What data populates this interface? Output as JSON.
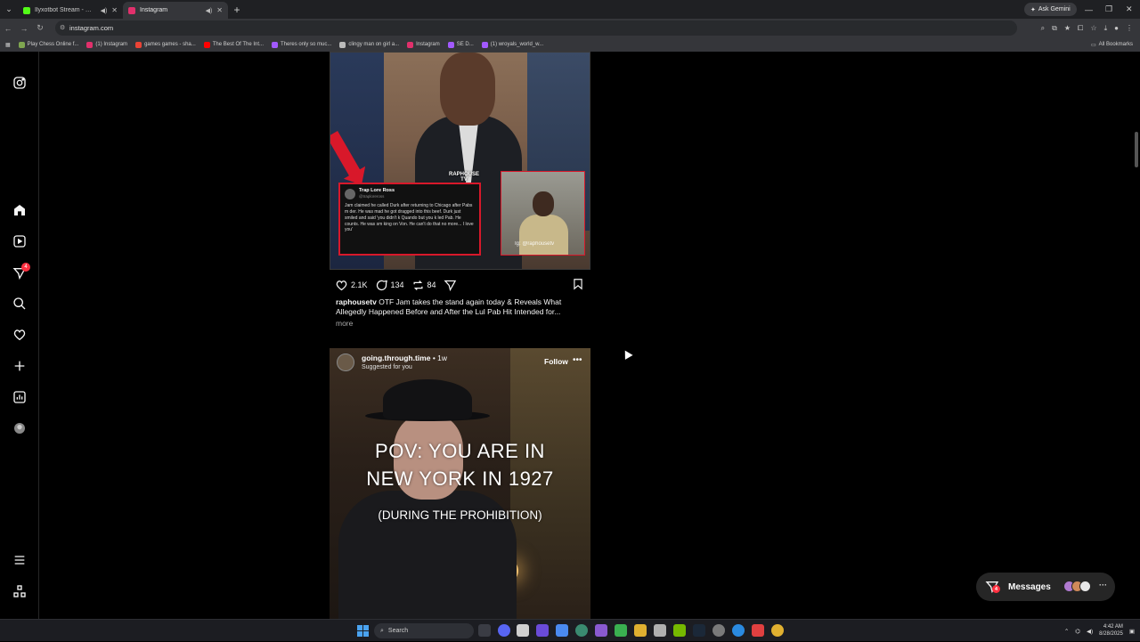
{
  "browser": {
    "tabs": [
      {
        "title": "Ilyxotbot Stream - Watch Li",
        "color": "#53fc18",
        "active": false
      },
      {
        "title": "Instagram",
        "color": "#e1306c",
        "active": true
      }
    ],
    "ask_gemini": "Ask Gemini",
    "url": "instagram.com",
    "bookmarks": [
      {
        "label": "Play Chess Online f...",
        "color": "#7fa650"
      },
      {
        "label": "(1) Instagram",
        "color": "#e1306c"
      },
      {
        "label": "games games - sha...",
        "color": "#ea4335"
      },
      {
        "label": "The Best Of The Int...",
        "color": "#ff0000"
      },
      {
        "label": "Theres only so muc...",
        "color": "#a259ff"
      },
      {
        "label": "clingy man on girl a...",
        "color": "#bbbbbb"
      },
      {
        "label": "Instagram",
        "color": "#e1306c"
      },
      {
        "label": "SE D...",
        "color": "#a259ff"
      },
      {
        "label": "(1) wroyals_world_w...",
        "color": "#a259ff"
      }
    ],
    "all_bookmarks": "All Bookmarks"
  },
  "sidebar": {
    "notification_badge": "4",
    "items": [
      "instagram-logo",
      "home",
      "reels",
      "messages",
      "search",
      "notifications",
      "create",
      "dashboard",
      "profile"
    ],
    "bottom": [
      "more",
      "also-from-meta"
    ]
  },
  "post1": {
    "tweet_name": "Trap Lore Ross",
    "tweet_handle": "@traploreross",
    "tweet_text": "Jam claimed he called Durk after returning to Chicago after Pabs m der. He was mad he got dragged into this beef. Durk just smiled and said 'you didn't k Quando but you k led Pab. He counts. He was sm king on Von. He can't do that no more... I love you'",
    "logo_text": "RAPHOUSE TV",
    "inset_label": "Ig: @raphousetv",
    "likes": "2.1K",
    "comments": "134",
    "reposts": "84",
    "caption_user": "raphousetv",
    "caption_text": "OTF Jam takes the stand again today & Reveals What Allegedly Happened Before and After the Lul Pab Hit Intended for...",
    "more": "more"
  },
  "post2": {
    "username": "going.through.time",
    "time": "• 1w",
    "suggested": "Suggested for you",
    "follow": "Follow",
    "overlay_line1": "POV: YOU ARE IN",
    "overlay_line2": "NEW YORK IN 1927",
    "overlay_line3": "(DURING THE PROHIBITION)"
  },
  "messages": {
    "label": "Messages",
    "badge": "4"
  },
  "taskbar": {
    "search": "Search",
    "time": "4:42 AM",
    "date": "8/28/2025"
  }
}
